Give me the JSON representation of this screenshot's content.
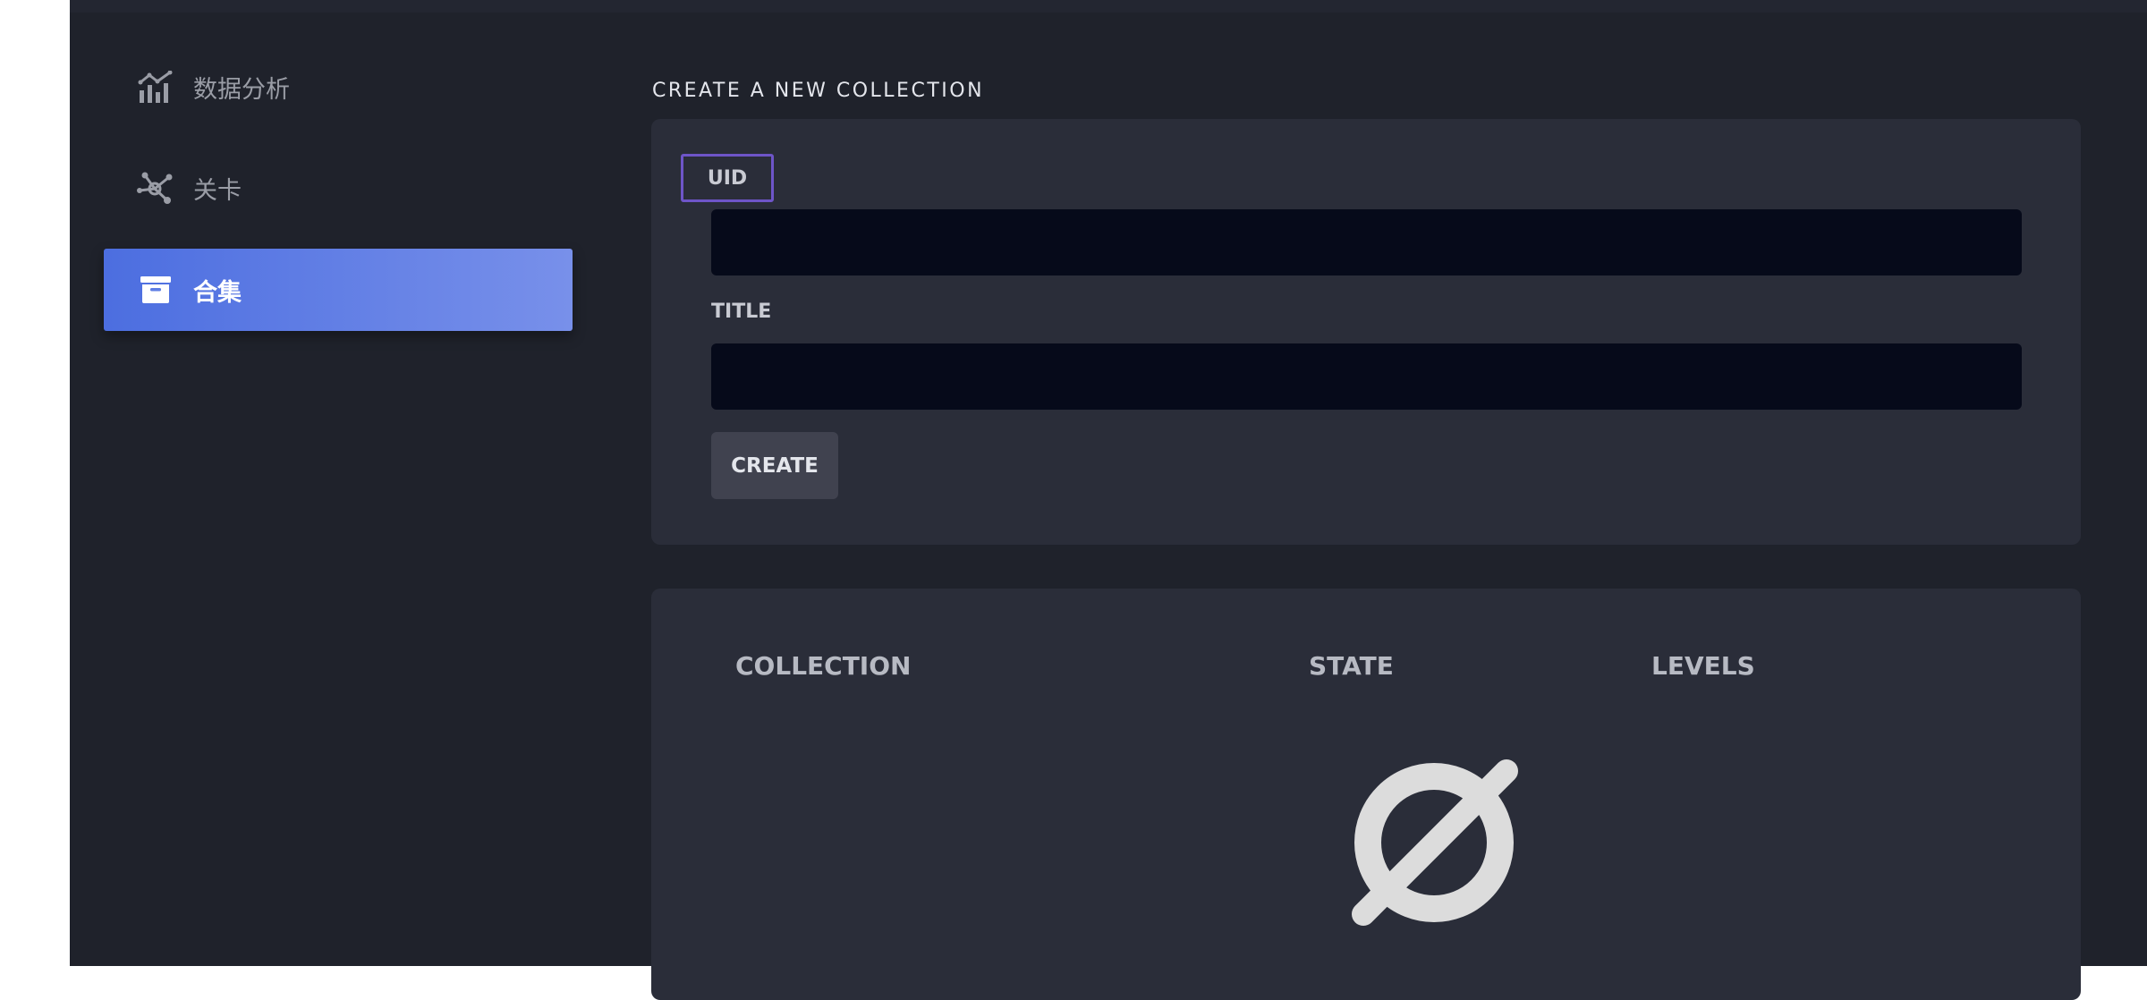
{
  "sidebar": {
    "items": [
      {
        "label": "数据分析",
        "icon": "chart-analytics-icon",
        "active": false
      },
      {
        "label": "关卡",
        "icon": "nodes-network-icon",
        "active": false
      },
      {
        "label": "合集",
        "icon": "archive-box-icon",
        "active": true
      }
    ]
  },
  "main": {
    "section_title": "CREATE A NEW COLLECTION",
    "form": {
      "uid_label": "UID",
      "uid_value": "",
      "title_label": "TITLE",
      "title_value": "",
      "create_label": "CREATE"
    },
    "table": {
      "columns": [
        "COLLECTION",
        "STATE",
        "LEVELS"
      ],
      "empty_icon": "empty-set-icon"
    }
  },
  "colors": {
    "accent_start": "#4c6ee0",
    "accent_end": "#7890ea",
    "background": "#1f222b",
    "card": "#2a2d39",
    "input": "#060a1a",
    "focus_outline": "#6e55c8"
  }
}
